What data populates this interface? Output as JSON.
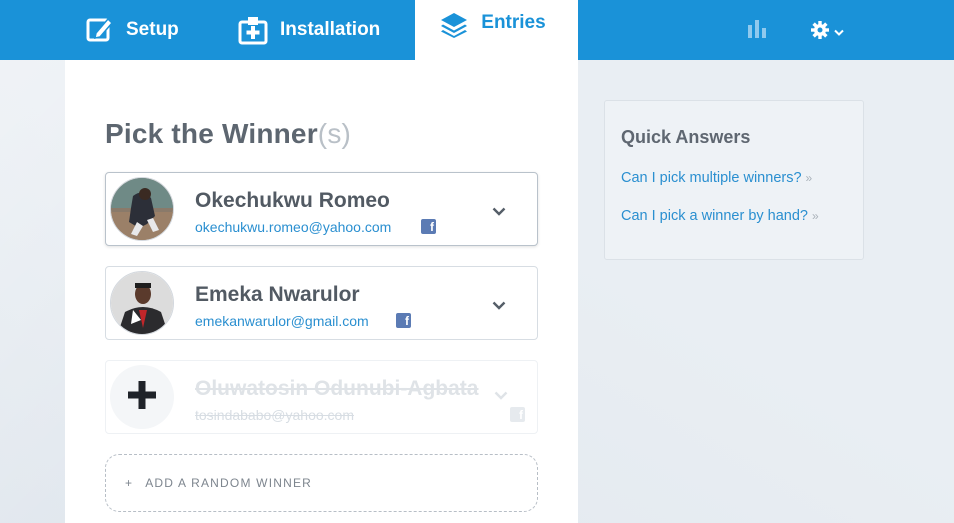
{
  "nav": {
    "tabs": [
      {
        "label": "Setup",
        "icon": "edit-icon"
      },
      {
        "label": "Installation",
        "icon": "install-icon"
      },
      {
        "label": "Entries",
        "icon": "layers-icon",
        "active": true
      }
    ],
    "right_icons": [
      "bar-chart-icon",
      "gear-icon"
    ]
  },
  "main": {
    "title": "Pick the Winner",
    "title_suffix": "(s)",
    "winners": [
      {
        "name": "Okechukwu Romeo",
        "email": "okechukwu.romeo@yahoo.com",
        "source_icon": "facebook-icon"
      },
      {
        "name": "Emeka Nwarulor",
        "email": "emekanwarulor@gmail.com",
        "source_icon": "facebook-icon"
      },
      {
        "name": "Oluwatosin Odunubi-Agbata",
        "email": "tosindababo@yahoo.com",
        "source_icon": "facebook-icon",
        "removed": true
      }
    ],
    "add_random_label": "ADD A RANDOM WINNER",
    "add_random_icon": "+"
  },
  "sidebar": {
    "title": "Quick Answers",
    "links": [
      "Can I pick multiple winners?",
      "Can I pick a winner by hand?"
    ]
  },
  "colors": {
    "brand": "#1a92d8",
    "link": "#2a8fd0",
    "facebook": "#5b7bb4"
  }
}
